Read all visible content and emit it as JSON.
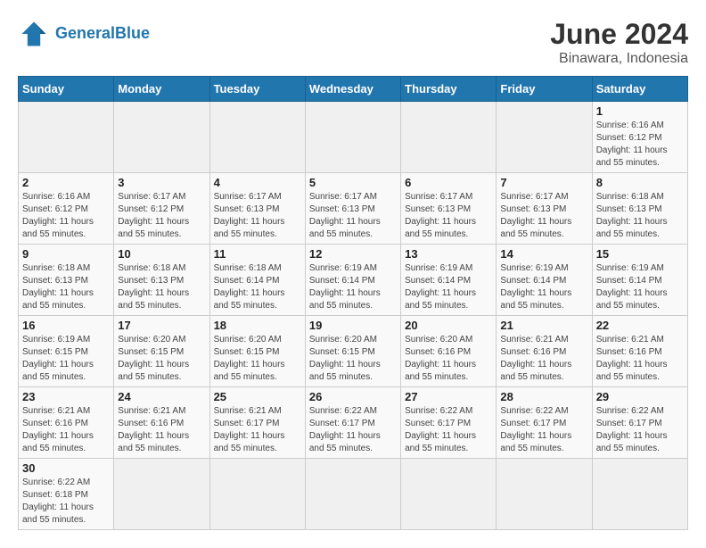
{
  "logo": {
    "general": "General",
    "blue": "Blue"
  },
  "title": {
    "month_year": "June 2024",
    "location": "Binawara, Indonesia"
  },
  "days_of_week": [
    "Sunday",
    "Monday",
    "Tuesday",
    "Wednesday",
    "Thursday",
    "Friday",
    "Saturday"
  ],
  "weeks": [
    [
      {
        "day": null,
        "info": null
      },
      {
        "day": null,
        "info": null
      },
      {
        "day": null,
        "info": null
      },
      {
        "day": null,
        "info": null
      },
      {
        "day": null,
        "info": null
      },
      {
        "day": null,
        "info": null
      },
      {
        "day": "1",
        "info": "Sunrise: 6:16 AM\nSunset: 6:12 PM\nDaylight: 11 hours and 55 minutes."
      }
    ],
    [
      {
        "day": "2",
        "info": "Sunrise: 6:16 AM\nSunset: 6:12 PM\nDaylight: 11 hours and 55 minutes."
      },
      {
        "day": "3",
        "info": "Sunrise: 6:17 AM\nSunset: 6:12 PM\nDaylight: 11 hours and 55 minutes."
      },
      {
        "day": "4",
        "info": "Sunrise: 6:17 AM\nSunset: 6:13 PM\nDaylight: 11 hours and 55 minutes."
      },
      {
        "day": "5",
        "info": "Sunrise: 6:17 AM\nSunset: 6:13 PM\nDaylight: 11 hours and 55 minutes."
      },
      {
        "day": "6",
        "info": "Sunrise: 6:17 AM\nSunset: 6:13 PM\nDaylight: 11 hours and 55 minutes."
      },
      {
        "day": "7",
        "info": "Sunrise: 6:17 AM\nSunset: 6:13 PM\nDaylight: 11 hours and 55 minutes."
      },
      {
        "day": "8",
        "info": "Sunrise: 6:18 AM\nSunset: 6:13 PM\nDaylight: 11 hours and 55 minutes."
      }
    ],
    [
      {
        "day": "9",
        "info": "Sunrise: 6:18 AM\nSunset: 6:13 PM\nDaylight: 11 hours and 55 minutes."
      },
      {
        "day": "10",
        "info": "Sunrise: 6:18 AM\nSunset: 6:13 PM\nDaylight: 11 hours and 55 minutes."
      },
      {
        "day": "11",
        "info": "Sunrise: 6:18 AM\nSunset: 6:14 PM\nDaylight: 11 hours and 55 minutes."
      },
      {
        "day": "12",
        "info": "Sunrise: 6:19 AM\nSunset: 6:14 PM\nDaylight: 11 hours and 55 minutes."
      },
      {
        "day": "13",
        "info": "Sunrise: 6:19 AM\nSunset: 6:14 PM\nDaylight: 11 hours and 55 minutes."
      },
      {
        "day": "14",
        "info": "Sunrise: 6:19 AM\nSunset: 6:14 PM\nDaylight: 11 hours and 55 minutes."
      },
      {
        "day": "15",
        "info": "Sunrise: 6:19 AM\nSunset: 6:14 PM\nDaylight: 11 hours and 55 minutes."
      }
    ],
    [
      {
        "day": "16",
        "info": "Sunrise: 6:19 AM\nSunset: 6:15 PM\nDaylight: 11 hours and 55 minutes."
      },
      {
        "day": "17",
        "info": "Sunrise: 6:20 AM\nSunset: 6:15 PM\nDaylight: 11 hours and 55 minutes."
      },
      {
        "day": "18",
        "info": "Sunrise: 6:20 AM\nSunset: 6:15 PM\nDaylight: 11 hours and 55 minutes."
      },
      {
        "day": "19",
        "info": "Sunrise: 6:20 AM\nSunset: 6:15 PM\nDaylight: 11 hours and 55 minutes."
      },
      {
        "day": "20",
        "info": "Sunrise: 6:20 AM\nSunset: 6:16 PM\nDaylight: 11 hours and 55 minutes."
      },
      {
        "day": "21",
        "info": "Sunrise: 6:21 AM\nSunset: 6:16 PM\nDaylight: 11 hours and 55 minutes."
      },
      {
        "day": "22",
        "info": "Sunrise: 6:21 AM\nSunset: 6:16 PM\nDaylight: 11 hours and 55 minutes."
      }
    ],
    [
      {
        "day": "23",
        "info": "Sunrise: 6:21 AM\nSunset: 6:16 PM\nDaylight: 11 hours and 55 minutes."
      },
      {
        "day": "24",
        "info": "Sunrise: 6:21 AM\nSunset: 6:16 PM\nDaylight: 11 hours and 55 minutes."
      },
      {
        "day": "25",
        "info": "Sunrise: 6:21 AM\nSunset: 6:17 PM\nDaylight: 11 hours and 55 minutes."
      },
      {
        "day": "26",
        "info": "Sunrise: 6:22 AM\nSunset: 6:17 PM\nDaylight: 11 hours and 55 minutes."
      },
      {
        "day": "27",
        "info": "Sunrise: 6:22 AM\nSunset: 6:17 PM\nDaylight: 11 hours and 55 minutes."
      },
      {
        "day": "28",
        "info": "Sunrise: 6:22 AM\nSunset: 6:17 PM\nDaylight: 11 hours and 55 minutes."
      },
      {
        "day": "29",
        "info": "Sunrise: 6:22 AM\nSunset: 6:17 PM\nDaylight: 11 hours and 55 minutes."
      }
    ],
    [
      {
        "day": "30",
        "info": "Sunrise: 6:22 AM\nSunset: 6:18 PM\nDaylight: 11 hours and 55 minutes."
      },
      {
        "day": null,
        "info": null
      },
      {
        "day": null,
        "info": null
      },
      {
        "day": null,
        "info": null
      },
      {
        "day": null,
        "info": null
      },
      {
        "day": null,
        "info": null
      },
      {
        "day": null,
        "info": null
      }
    ]
  ]
}
